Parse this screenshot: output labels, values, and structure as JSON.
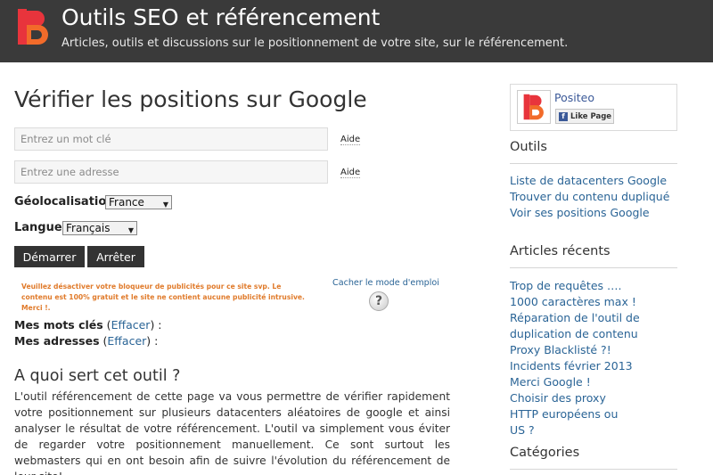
{
  "header": {
    "title": "Outils SEO et référencement",
    "description": "Articles, outils et discussions sur le positionnement de votre site, sur le référencement.",
    "logo_icon": "positeo-logo-icon",
    "colors": {
      "background": "#3a3a3a",
      "logo_red": "#e8343c",
      "logo_orange": "#f26b2a"
    }
  },
  "main": {
    "page_title": "Vérifier les positions sur Google",
    "keyword_input": {
      "placeholder": "Entrez un mot clé",
      "value": ""
    },
    "keyword_help": "Aide",
    "address_input": {
      "placeholder": "Entrez une adresse",
      "value": ""
    },
    "address_help": "Aide",
    "geo_label": "Géolocalisation :",
    "geo_selected": "France",
    "lang_label": "Langue :",
    "lang_selected": "Français",
    "start_button": "Démarrer",
    "stop_button": "Arrêter",
    "adblock_notice": "Veuillez désactiver votre bloqueur de publicités pour ce site svp. Le contenu est 100% gratuit et le site ne contient aucune publicité intrusive. Merci !.",
    "hide_instructions": "Cacher le mode d'emploi",
    "help_icon": "question-mark-icon",
    "my_keywords": {
      "label": "Mes mots clés",
      "clear": "Effacer",
      "open": " (",
      "close": ") :"
    },
    "my_addresses": {
      "label": "Mes adresses",
      "clear": "Effacer",
      "open": " (",
      "close": ") :"
    },
    "section_title": "A quoi sert cet outil ?",
    "section_body": "L'outil référencement de cette page va vous permettre de vérifier rapidement votre positionnement sur plusieurs datacenters aléatoires de google et ainsi analyser le résultat de votre référencement. L'outil va simplement vous éviter de regarder votre positionnement manuellement. Ce sont surtout les webmasters qui en ont besoin afin de suivre l'évolution du référencement de leur site!",
    "colors": {
      "accent_link": "#2a6496",
      "notice": "#e07a2a",
      "button": "#333333"
    }
  },
  "sidebar": {
    "facebook": {
      "page_name": "Positeo",
      "like_label": "Like Page",
      "like_icon": "facebook-f-icon"
    },
    "outils_title": "Outils",
    "outils_links": [
      "Liste de datacenters Google",
      "Trouver du contenu dupliqué",
      "Voir ses positions Google"
    ],
    "articles_title": "Articles récents",
    "articles_links": [
      "Trop de requêtes …. 1000 caractères max !",
      "Réparation de l'outil de duplication de contenu",
      "Proxy Blacklisté ?!",
      "Incidents février 2013 Merci Google !",
      "Choisir des proxy HTTP européens ou US ?"
    ],
    "categories_title": "Catégories"
  }
}
